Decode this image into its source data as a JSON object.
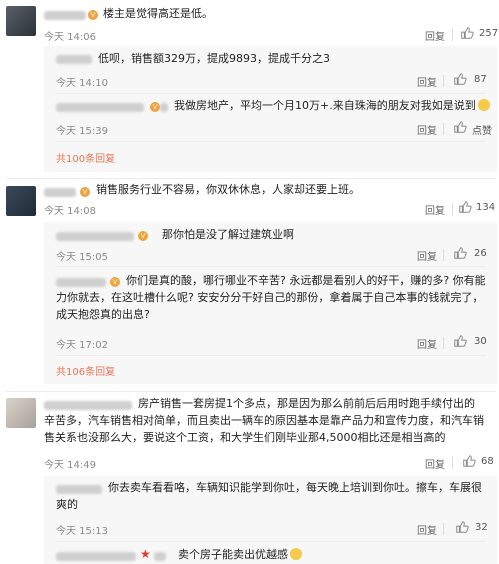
{
  "comments": [
    {
      "text": "楼主是觉得高还是低。",
      "time": "今天 14:06",
      "reply_label": "回复",
      "likes": "257",
      "replies": [
        {
          "text": "低呗，销售额329万，提成9893，提成千分之3",
          "time": "今天 14:10",
          "reply_label": "回复",
          "likes": "87"
        },
        {
          "text": "我做房地产，平均一个月10万+.来自珠海的朋友对我如是说到",
          "time": "今天 15:39",
          "reply_label": "回复",
          "likes": "点赞"
        }
      ],
      "more": "共100条回复"
    },
    {
      "text": "销售服务行业不容易，你双休休息，人家却还要上班。",
      "time": "今天 14:08",
      "reply_label": "回复",
      "likes": "134",
      "replies": [
        {
          "text": "那你怕是没了解过建筑业啊",
          "time": "今天 15:05",
          "reply_label": "回复",
          "likes": "26"
        },
        {
          "text": "你们是真的酸，哪行哪业不辛苦? 永远都是看别人的好干，赚的多? 你有能力你就去，在这吐槽什么呢? 安安分分干好自己的那份，拿着属于自己本事的钱就完了，成天抱怨真的出息?",
          "time": "今天 17:02",
          "reply_label": "回复",
          "likes": "30"
        }
      ],
      "more": "共106条回复"
    },
    {
      "text": "房产销售一套房提1个多点，那是因为那么前前后后用时跑手续付出的辛苦多，汽车销售相对简单，而且卖出一辆车的原因基本是靠产品力和宣传力度，和汽车销售关系也没那么大，要说这个工资，和大学生们刚毕业那4,5000相比还是相当高的",
      "time": "今天 14:49",
      "reply_label": "回复",
      "likes": "68",
      "replies": [
        {
          "text": "你去卖车看看咯，车辆知识能学到你吐，每天晚上培训到你吐。擦车，车展很爽的",
          "time": "今天 15:13",
          "reply_label": "回复",
          "likes": "32"
        },
        {
          "text": "卖个房子能卖出优越感",
          "time": "",
          "reply_label": "",
          "likes": ""
        }
      ]
    }
  ],
  "icons": {
    "thumb": "thumbs-up-icon",
    "vip": "vip-badge-icon",
    "emoji": "emoji-icon"
  }
}
